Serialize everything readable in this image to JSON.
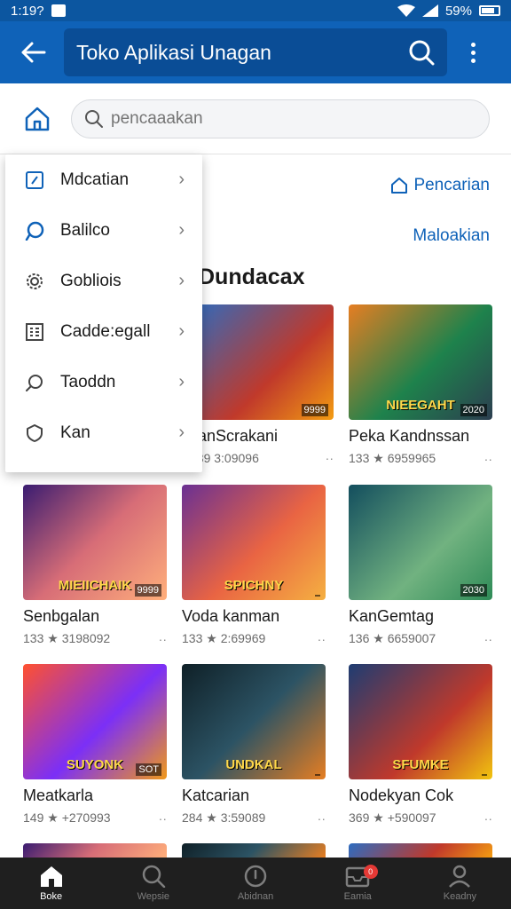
{
  "status_bar": {
    "time": "1:19?",
    "battery": "59%"
  },
  "app_bar": {
    "title": "Toko Apl‍ikasi Unagan"
  },
  "search": {
    "placeholder": "pencaaakan"
  },
  "links": {
    "top": "Pencarian",
    "bottom": "Maloakian"
  },
  "section": {
    "title": "Dundacax"
  },
  "drawer": {
    "items": [
      {
        "label": "Mdcatian",
        "icon": "edit-icon"
      },
      {
        "label": "Balilco",
        "icon": "chat-icon"
      },
      {
        "label": "Gobliois",
        "icon": "gear-icon"
      },
      {
        "label": "Cadde:egall",
        "icon": "grid-icon"
      },
      {
        "label": "Taoddn",
        "icon": "search-icon"
      },
      {
        "label": "Kan",
        "icon": "shield-icon"
      }
    ]
  },
  "grid": [
    {
      "name": "kanScrakani",
      "meta": "139 3:09096",
      "art": "",
      "tag": "9999"
    },
    {
      "name": "Peka Kandnssan",
      "meta": "133 ★ 6959965",
      "art": "NIEEGAHT",
      "tag": "2020"
    },
    {
      "name": "Senbgalan",
      "meta": "133 ★ 3198092",
      "art": "MIEIICHAIK",
      "tag": "9999"
    },
    {
      "name": "Voda kanman",
      "meta": "133 ★ 2:69969",
      "art": "SPICHNY",
      "tag": ""
    },
    {
      "name": "KanGemtag",
      "meta": "136 ★ 6659007",
      "art": "",
      "tag": "2030"
    },
    {
      "name": "Meatkarla",
      "meta": "149 ★ +270993",
      "art": "SUYONK",
      "tag": "SOT"
    },
    {
      "name": "Katcarian",
      "meta": "284 ★ 3:59089",
      "art": "UNDKAL",
      "tag": ""
    },
    {
      "name": "Nodekyan Cok",
      "meta": "369 ★ +590097",
      "art": "SFUMKE",
      "tag": ""
    }
  ],
  "bottom_nav": [
    {
      "label": "Boke",
      "active": true
    },
    {
      "label": "Wepsie",
      "active": false
    },
    {
      "label": "Abidnan",
      "active": false
    },
    {
      "label": "Eamia",
      "active": false,
      "badge": "0"
    },
    {
      "label": "Keadny",
      "active": false
    }
  ]
}
